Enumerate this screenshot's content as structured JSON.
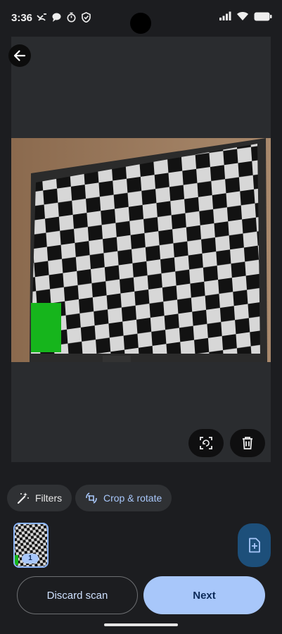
{
  "status_bar": {
    "time": "3:36"
  },
  "actions": {
    "filters_label": "Filters",
    "crop_rotate_label": "Crop & rotate",
    "page_badge": "1",
    "discard_label": "Discard scan",
    "next_label": "Next"
  },
  "colors": {
    "accent": "#a8c7fa",
    "fab": "#1d4f7a",
    "background": "#1c1d20"
  },
  "icons": {
    "back": "arrow-left-icon",
    "recrop": "auto-crop-icon",
    "delete": "trash-icon",
    "filters": "magic-wand-icon",
    "crop": "crop-rotate-icon",
    "add_page": "add-document-icon"
  }
}
